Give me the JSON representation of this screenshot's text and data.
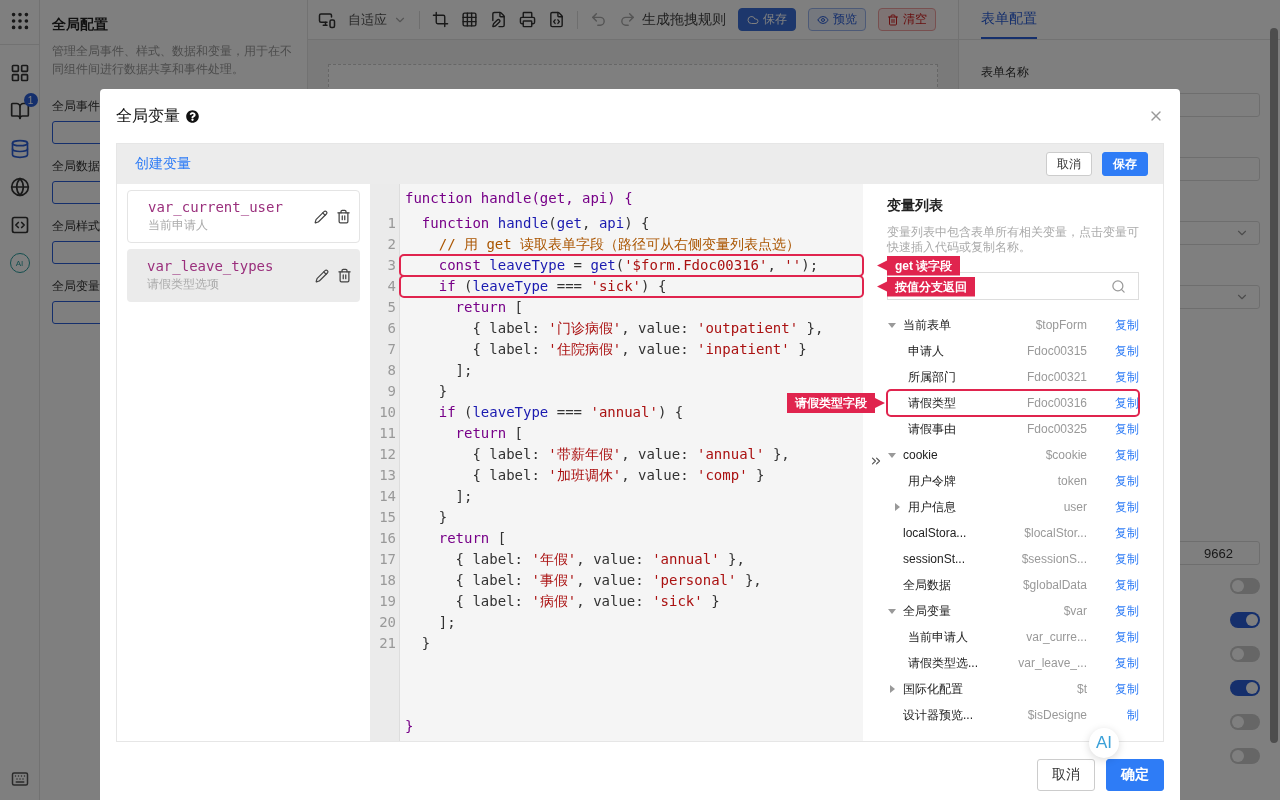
{
  "rail": {
    "badge": "1",
    "ai_label": "AI"
  },
  "left_panel": {
    "title": "全局配置",
    "description": "管理全局事件、样式、数据和变量，用于在不同组件间进行数据共享和事件处理。",
    "sections": [
      {
        "label": "全局事件"
      },
      {
        "label": "全局数据"
      },
      {
        "label": "全局样式"
      },
      {
        "label": "全局变量"
      }
    ]
  },
  "toolbar": {
    "zoom_mode": "自适应",
    "generate": "生成拖拽规则",
    "buttons": [
      {
        "label": "保存",
        "kind": "primary"
      },
      {
        "label": "预览",
        "kind": "outline"
      },
      {
        "label": "清空",
        "kind": "danger"
      }
    ]
  },
  "right_panel": {
    "tabs": [
      {
        "label": "表单配置",
        "selected": true
      }
    ],
    "form_name_label": "表单名称",
    "fields": [
      {
        "kind": "input"
      },
      {
        "kind": "input"
      },
      {
        "kind": "select"
      },
      {
        "kind": "select"
      },
      {
        "kind": "input",
        "value": "9662"
      },
      {
        "kind": "switch",
        "on": false
      },
      {
        "kind": "switch",
        "on": true
      },
      {
        "kind": "switch",
        "on": false
      },
      {
        "kind": "switch",
        "on": true
      },
      {
        "kind": "switch",
        "on": false
      },
      {
        "kind": "switch",
        "on": false
      }
    ]
  },
  "dialog": {
    "title": "全局变量",
    "create_link": "创建变量",
    "header_buttons": [
      {
        "label": "取消",
        "kind": "default"
      },
      {
        "label": "保存",
        "kind": "primary"
      }
    ],
    "variables": [
      {
        "name": "var_current_user",
        "description": "当前申请人",
        "selected": false
      },
      {
        "name": "var_leave_types",
        "description": "请假类型选项",
        "selected": true
      }
    ],
    "editor": {
      "header": "function handle(get, api) {",
      "footer": "}",
      "lines": [
        {
          "number": "1",
          "tokens": [
            {
              "kind": "keyword",
              "text": "  function "
            },
            {
              "kind": "name",
              "text": "handle"
            },
            {
              "kind": "plain",
              "text": "("
            },
            {
              "kind": "name",
              "text": "get"
            },
            {
              "kind": "plain",
              "text": ", "
            },
            {
              "kind": "name",
              "text": "api"
            },
            {
              "kind": "plain",
              "text": ") {"
            }
          ]
        },
        {
          "number": "2",
          "tokens": [
            {
              "kind": "comment",
              "text": "    // 用 get 读取表单字段（路径可从右侧变量列表点选）"
            }
          ]
        },
        {
          "number": "3",
          "callout": "get 读字段",
          "tokens": [
            {
              "kind": "keyword",
              "text": "    const "
            },
            {
              "kind": "name",
              "text": "leaveType"
            },
            {
              "kind": "plain",
              "text": " = "
            },
            {
              "kind": "name",
              "text": "get"
            },
            {
              "kind": "plain",
              "text": "("
            },
            {
              "kind": "string",
              "text": "'$form.Fdoc00316'"
            },
            {
              "kind": "plain",
              "text": ", "
            },
            {
              "kind": "string",
              "text": "''"
            },
            {
              "kind": "plain",
              "text": ");"
            }
          ]
        },
        {
          "number": "4",
          "callout": "按值分支返回",
          "tokens": [
            {
              "kind": "keyword",
              "text": "    if"
            },
            {
              "kind": "plain",
              "text": " ("
            },
            {
              "kind": "name",
              "text": "leaveType"
            },
            {
              "kind": "plain",
              "text": " === "
            },
            {
              "kind": "string",
              "text": "'sick'"
            },
            {
              "kind": "plain",
              "text": ") {"
            }
          ]
        },
        {
          "number": "5",
          "tokens": [
            {
              "kind": "keyword",
              "text": "      return"
            },
            {
              "kind": "plain",
              "text": " ["
            }
          ]
        },
        {
          "number": "6",
          "tokens": [
            {
              "kind": "plain",
              "text": "        { label: "
            },
            {
              "kind": "string",
              "text": "'门诊病假'"
            },
            {
              "kind": "plain",
              "text": ", value: "
            },
            {
              "kind": "string",
              "text": "'outpatient'"
            },
            {
              "kind": "plain",
              "text": " },"
            }
          ]
        },
        {
          "number": "7",
          "tokens": [
            {
              "kind": "plain",
              "text": "        { label: "
            },
            {
              "kind": "string",
              "text": "'住院病假'"
            },
            {
              "kind": "plain",
              "text": ", value: "
            },
            {
              "kind": "string",
              "text": "'inpatient'"
            },
            {
              "kind": "plain",
              "text": " }"
            }
          ]
        },
        {
          "number": "8",
          "tokens": [
            {
              "kind": "plain",
              "text": "      ];"
            }
          ]
        },
        {
          "number": "9",
          "tokens": [
            {
              "kind": "plain",
              "text": "    }"
            }
          ]
        },
        {
          "number": "10",
          "tokens": [
            {
              "kind": "keyword",
              "text": "    if"
            },
            {
              "kind": "plain",
              "text": " ("
            },
            {
              "kind": "name",
              "text": "leaveType"
            },
            {
              "kind": "plain",
              "text": " === "
            },
            {
              "kind": "string",
              "text": "'annual'"
            },
            {
              "kind": "plain",
              "text": ") {"
            }
          ]
        },
        {
          "number": "11",
          "tokens": [
            {
              "kind": "keyword",
              "text": "      return"
            },
            {
              "kind": "plain",
              "text": " ["
            }
          ]
        },
        {
          "number": "12",
          "tokens": [
            {
              "kind": "plain",
              "text": "        { label: "
            },
            {
              "kind": "string",
              "text": "'带薪年假'"
            },
            {
              "kind": "plain",
              "text": ", value: "
            },
            {
              "kind": "string",
              "text": "'annual'"
            },
            {
              "kind": "plain",
              "text": " },"
            }
          ]
        },
        {
          "number": "13",
          "tokens": [
            {
              "kind": "plain",
              "text": "        { label: "
            },
            {
              "kind": "string",
              "text": "'加班调休'"
            },
            {
              "kind": "plain",
              "text": ", value: "
            },
            {
              "kind": "string",
              "text": "'comp'"
            },
            {
              "kind": "plain",
              "text": " }"
            }
          ]
        },
        {
          "number": "14",
          "tokens": [
            {
              "kind": "plain",
              "text": "      ];"
            }
          ]
        },
        {
          "number": "15",
          "tokens": [
            {
              "kind": "plain",
              "text": "    }"
            }
          ]
        },
        {
          "number": "16",
          "tokens": [
            {
              "kind": "keyword",
              "text": "    return"
            },
            {
              "kind": "plain",
              "text": " ["
            }
          ]
        },
        {
          "number": "17",
          "tokens": [
            {
              "kind": "plain",
              "text": "      { label: "
            },
            {
              "kind": "string",
              "text": "'年假'"
            },
            {
              "kind": "plain",
              "text": ", value: "
            },
            {
              "kind": "string",
              "text": "'annual'"
            },
            {
              "kind": "plain",
              "text": " },"
            }
          ]
        },
        {
          "number": "18",
          "tokens": [
            {
              "kind": "plain",
              "text": "      { label: "
            },
            {
              "kind": "string",
              "text": "'事假'"
            },
            {
              "kind": "plain",
              "text": ", value: "
            },
            {
              "kind": "string",
              "text": "'personal'"
            },
            {
              "kind": "plain",
              "text": " },"
            }
          ]
        },
        {
          "number": "19",
          "tokens": [
            {
              "kind": "plain",
              "text": "      { label: "
            },
            {
              "kind": "string",
              "text": "'病假'"
            },
            {
              "kind": "plain",
              "text": ", value: "
            },
            {
              "kind": "string",
              "text": "'sick'"
            },
            {
              "kind": "plain",
              "text": " }"
            }
          ]
        },
        {
          "number": "20",
          "tokens": [
            {
              "kind": "plain",
              "text": "    ];"
            }
          ]
        },
        {
          "number": "21",
          "tokens": [
            {
              "kind": "plain",
              "text": "  }"
            }
          ]
        }
      ]
    },
    "variable_panel": {
      "title": "变量列表",
      "description": "变量列表中包含表单所有相关变量，点击变量可快速插入代码或复制名称。",
      "tree": [
        {
          "label": "当前表单",
          "path": "$topForm",
          "action": "复制",
          "expanded": true,
          "children": [
            {
              "label": "申请人",
              "path": "Fdoc00315",
              "action": "复制"
            },
            {
              "label": "所属部门",
              "path": "Fdoc00321",
              "action": "复制"
            },
            {
              "label": "请假类型",
              "path": "Fdoc00316",
              "action": "复制",
              "callout": "请假类型字段"
            },
            {
              "label": "请假事由",
              "path": "Fdoc00325",
              "action": "复制"
            }
          ]
        },
        {
          "label": "cookie",
          "path": "$cookie",
          "action": "复制",
          "expanded": true,
          "children": [
            {
              "label": "用户令牌",
              "path": "token",
              "action": "复制"
            },
            {
              "label": "用户信息",
              "path": "user",
              "action": "复制",
              "expanded": false
            }
          ]
        },
        {
          "label": "localStora...",
          "path": "$localStor...",
          "action": "复制"
        },
        {
          "label": "sessionSt...",
          "path": "$sessionS...",
          "action": "复制"
        },
        {
          "label": "全局数据",
          "path": "$globalData",
          "action": "复制"
        },
        {
          "label": "全局变量",
          "path": "$var",
          "action": "复制",
          "expanded": true,
          "children": [
            {
              "label": "当前申请人",
              "path": "var_curre...",
              "action": "复制"
            },
            {
              "label": "请假类型选...",
              "path": "var_leave_...",
              "action": "复制"
            }
          ]
        },
        {
          "label": "国际化配置",
          "path": "$t",
          "action": "复制",
          "expanded": false
        },
        {
          "label": "设计器预览...",
          "path": "$isDesigne",
          "action": "制"
        }
      ],
      "ai_button": "AI"
    },
    "footer_buttons": [
      {
        "label": "取消",
        "kind": "default"
      },
      {
        "label": "确定",
        "kind": "primary"
      }
    ]
  }
}
